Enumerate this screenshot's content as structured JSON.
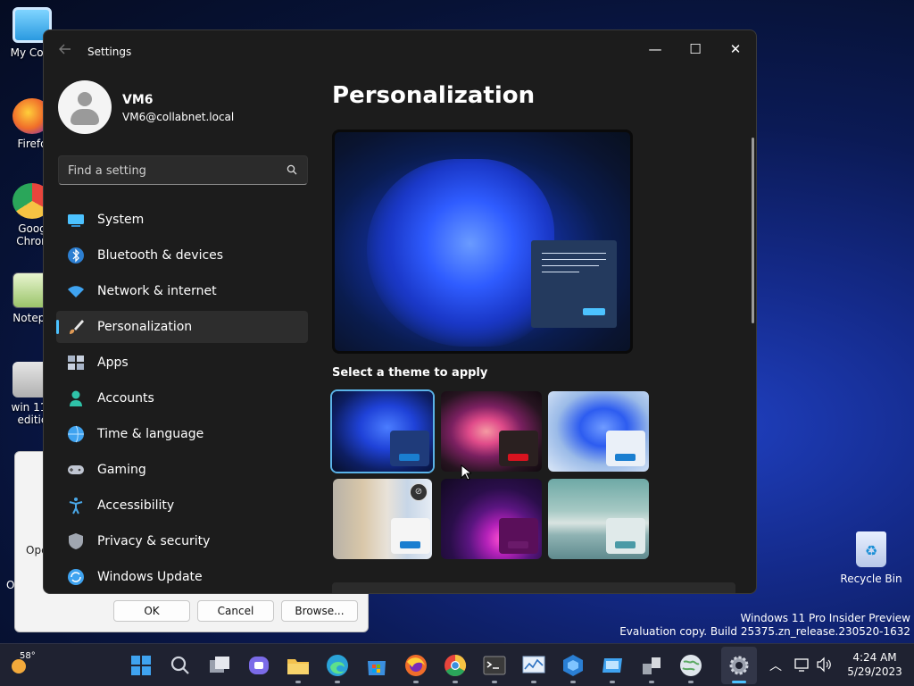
{
  "desktop": {
    "icons": [
      {
        "label": "My Com"
      },
      {
        "label": "Firefo"
      },
      {
        "label": "Goog Chron"
      },
      {
        "label": "Notepa"
      },
      {
        "label": "win 11 l editic"
      }
    ],
    "recycle_bin_label": "Recycle Bin",
    "watermark_line1": "Windows 11 Pro Insider Preview",
    "watermark_line2": "Evaluation copy. Build 25375.zn_release.230520-1632",
    "background_dialog": {
      "ok_label": "OK",
      "cancel_label": "Cancel",
      "browse_label": "Browse...",
      "side_text_1": "Ope",
      "side_text_2": "O"
    }
  },
  "settings": {
    "window_title": "Settings",
    "controls": {
      "minimize": "—",
      "maximize": "☐",
      "close": "✕"
    },
    "user": {
      "name": "VM6",
      "email": "VM6@collabnet.local"
    },
    "search": {
      "placeholder": "Find a setting"
    },
    "nav": [
      {
        "label": "System",
        "icon": "system-icon",
        "color": "#4cc2ff"
      },
      {
        "label": "Bluetooth & devices",
        "icon": "bluetooth-icon",
        "color": "#4aa8e8"
      },
      {
        "label": "Network & internet",
        "icon": "wifi-icon",
        "color": "#3fa3f0"
      },
      {
        "label": "Personalization",
        "icon": "brush-icon",
        "color": "#e09a55",
        "active": true
      },
      {
        "label": "Apps",
        "icon": "apps-icon",
        "color": "#a8b4c8"
      },
      {
        "label": "Accounts",
        "icon": "accounts-icon",
        "color": "#2fc2a8"
      },
      {
        "label": "Time & language",
        "icon": "globe-clock-icon",
        "color": "#3fa3f0"
      },
      {
        "label": "Gaming",
        "icon": "gamepad-icon",
        "color": "#c0c6d2"
      },
      {
        "label": "Accessibility",
        "icon": "accessibility-icon",
        "color": "#4aa8e8"
      },
      {
        "label": "Privacy & security",
        "icon": "shield-icon",
        "color": "#a0a6b0"
      },
      {
        "label": "Windows Update",
        "icon": "update-icon",
        "color": "#3fa3f0"
      }
    ],
    "page_title": "Personalization",
    "theme_heading": "Select a theme to apply",
    "themes": [
      {
        "name": "windows-dark-bloom",
        "selected": true,
        "button_color": "#1a7ed0",
        "card_color": "#1f3b7a"
      },
      {
        "name": "glow-flower",
        "selected": false,
        "button_color": "#d8131f",
        "card_color": "#2a2020"
      },
      {
        "name": "windows-light-bloom",
        "selected": false,
        "button_color": "#1a7ed0",
        "card_color": "#eaf0f8"
      },
      {
        "name": "captured-motion",
        "selected": false,
        "button_color": "#1a7ed0",
        "card_color": "#f5f5f5",
        "badge": "⊘"
      },
      {
        "name": "flow",
        "selected": false,
        "button_color": "#6a1a6a",
        "card_color": "#5a0f5a"
      },
      {
        "name": "sunrise",
        "selected": false,
        "button_color": "#4a9aa6",
        "card_color": "#e0eaea"
      }
    ]
  },
  "taskbar": {
    "weather_temp": "58°",
    "apps": [
      {
        "name": "start-icon",
        "color": "#3fa3f0"
      },
      {
        "name": "search-icon",
        "color": "#cfd3dc"
      },
      {
        "name": "task-view-icon",
        "color": "#cfd3dc"
      },
      {
        "name": "teams-chat-icon",
        "color": "#7b6be8"
      },
      {
        "name": "file-explorer-icon",
        "color": "#f2c14e"
      },
      {
        "name": "edge-icon",
        "color": "#2aa3d8"
      },
      {
        "name": "store-icon",
        "color": "#3a8fe0"
      },
      {
        "name": "firefox-icon",
        "color": "#f06d2a"
      },
      {
        "name": "chrome-icon",
        "color": "#e8453c"
      },
      {
        "name": "terminal-icon",
        "color": "#3a3a3a"
      },
      {
        "name": "resource-monitor-icon",
        "color": "#8fb0d6"
      },
      {
        "name": "app-icon",
        "color": "#2a7fd4"
      },
      {
        "name": "remote-desktop-icon",
        "color": "#3fa3f0"
      },
      {
        "name": "network-icon",
        "color": "#a0a6b0"
      },
      {
        "name": "globe-app-icon",
        "color": "#5aa860"
      },
      {
        "name": "settings-gear-icon",
        "color": "#9aa0ad"
      }
    ],
    "tray": {
      "chevron": "︿",
      "clock_time": "4:24 AM",
      "clock_date": "5/29/2023"
    }
  }
}
